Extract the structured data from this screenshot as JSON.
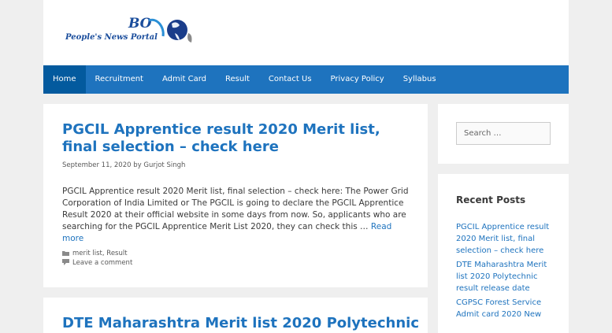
{
  "site": {
    "logo_initials": "BO",
    "logo_text": "People's News Portal"
  },
  "nav": {
    "items": [
      {
        "label": "Home",
        "active": true
      },
      {
        "label": "Recruitment",
        "active": false
      },
      {
        "label": "Admit Card",
        "active": false
      },
      {
        "label": "Result",
        "active": false
      },
      {
        "label": "Contact Us",
        "active": false
      },
      {
        "label": "Privacy Policy",
        "active": false
      },
      {
        "label": "Syllabus",
        "active": false
      }
    ]
  },
  "article": {
    "title": "PGCIL Apprentice result 2020 Merit list, final selection – check here",
    "date": "September 11, 2020",
    "by": "by",
    "author": "Gurjot Singh",
    "excerpt": "PGCIL Apprentice result 2020 Merit list, final selection – check here: The Power Grid Corporation of India Limited or The PGCIL is going to declare the PGCIL Apprentice Result 2020 at their official website in some days from now. So, applicants who are searching for the PGCIL Apprentice Merit List 2020, they can check this … ",
    "read_more": "Read more",
    "categories": [
      "merit list",
      "Result"
    ],
    "categories_sep": ", ",
    "comment_link": "Leave a comment"
  },
  "article2": {
    "title": "DTE Maharashtra Merit list 2020 Polytechnic"
  },
  "sidebar": {
    "search_placeholder": "Search …",
    "recent_title": "Recent Posts",
    "recent_posts": [
      "PGCIL Apprentice result 2020 Merit list, final selection – check here",
      "DTE Maharashtra Merit list 2020 Polytechnic result release date",
      "CGPSC Forest Service Admit card 2020 New"
    ]
  },
  "colors": {
    "accent": "#1e73be",
    "nav_active": "#035a9e",
    "background": "#efefef"
  }
}
